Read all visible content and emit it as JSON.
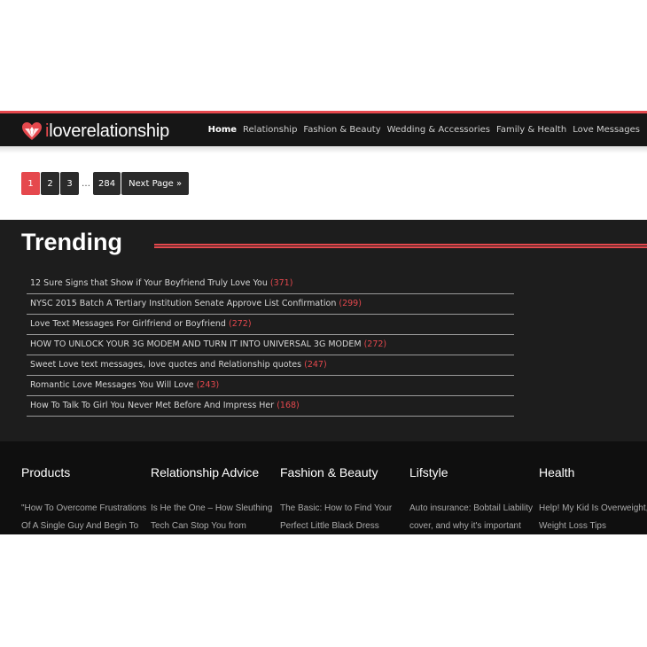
{
  "header": {
    "logo_text": "iloverelationship",
    "logo_prefix": "i",
    "logo_rest": "loverelationship",
    "nav": [
      {
        "label": "Home",
        "active": true
      },
      {
        "label": "Relationship"
      },
      {
        "label": "Fashion & Beauty"
      },
      {
        "label": "Wedding & Accessories"
      },
      {
        "label": "Family & Health"
      },
      {
        "label": "Love Messages"
      }
    ]
  },
  "pagination": {
    "pages": [
      "1",
      "2",
      "3"
    ],
    "current": "1",
    "ellipsis": "…",
    "last": "284",
    "next_label": "Next Page »"
  },
  "trending": {
    "title": "Trending",
    "items": [
      {
        "title": "12 Sure Signs that Show if Your Boyfriend Truly Love You",
        "count": "(371)"
      },
      {
        "title": "NYSC 2015 Batch A Tertiary Institution Senate Approve List Confirmation",
        "count": "(299)"
      },
      {
        "title": "Love Text Messages For Girlfriend or Boyfriend",
        "count": "(272)"
      },
      {
        "title": "HOW TO UNLOCK YOUR 3G MODEM AND TURN IT INTO UNIVERSAL 3G MODEM",
        "count": "(272)"
      },
      {
        "title": "Sweet Love text messages, love quotes and Relationship quotes",
        "count": "(247)"
      },
      {
        "title": "Romantic Love Messages You Will Love",
        "count": "(243)"
      },
      {
        "title": "How To Talk To Girl You Never Met Before And Impress Her",
        "count": "(168)"
      }
    ]
  },
  "footer": {
    "columns": [
      {
        "heading": "Products",
        "text": "\"How To Overcome Frustrations Of A Single Guy And Begin To"
      },
      {
        "heading": "Relationship Advice",
        "text": "Is He the One – How Sleuthing Tech Can Stop You from"
      },
      {
        "heading": "Fashion & Beauty",
        "text": "The Basic: How to Find Your Perfect Little Black Dress"
      },
      {
        "heading": "Lifstyle",
        "text": "Auto insurance: Bobtail Liability cover, and why it's important"
      },
      {
        "heading": "Health",
        "text": "Help! My Kid Is Overweight, Safe Weight Loss Tips"
      }
    ]
  },
  "colors": {
    "accent": "#e5484d",
    "header_bg": "#161616",
    "trending_bg": "#1d1d1d",
    "footer_bg": "#0f0f0f"
  }
}
